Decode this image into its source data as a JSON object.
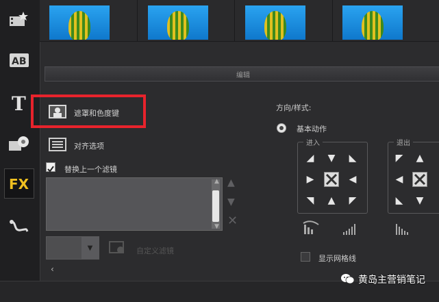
{
  "edit_tab": {
    "label": "编辑"
  },
  "left_options": {
    "mask_chroma_key": "遮罩和色度键",
    "align_options": "对齐选项",
    "replace_last_filter": "替换上一个滤镜",
    "replace_last_filter_checked": true,
    "custom_filter": "自定义滤镜"
  },
  "right_panel": {
    "direction_style_label": "方向/样式:",
    "basic_motion_label": "基本动作",
    "enter_group": "进入",
    "exit_group": "退出",
    "show_grid_label": "显示网格线",
    "show_grid_checked": false
  },
  "toolbar_icons": [
    "media-icon",
    "title-ab-icon",
    "text-t-icon",
    "graphic-icon",
    "fx-icon",
    "path-icon"
  ],
  "watermark": {
    "text": "黄岛主营销笔记",
    "icon": "wechat-icon"
  },
  "colors": {
    "highlight": "#e8232c",
    "background": "#2c2c2e",
    "sky": "#1f8ce0"
  }
}
